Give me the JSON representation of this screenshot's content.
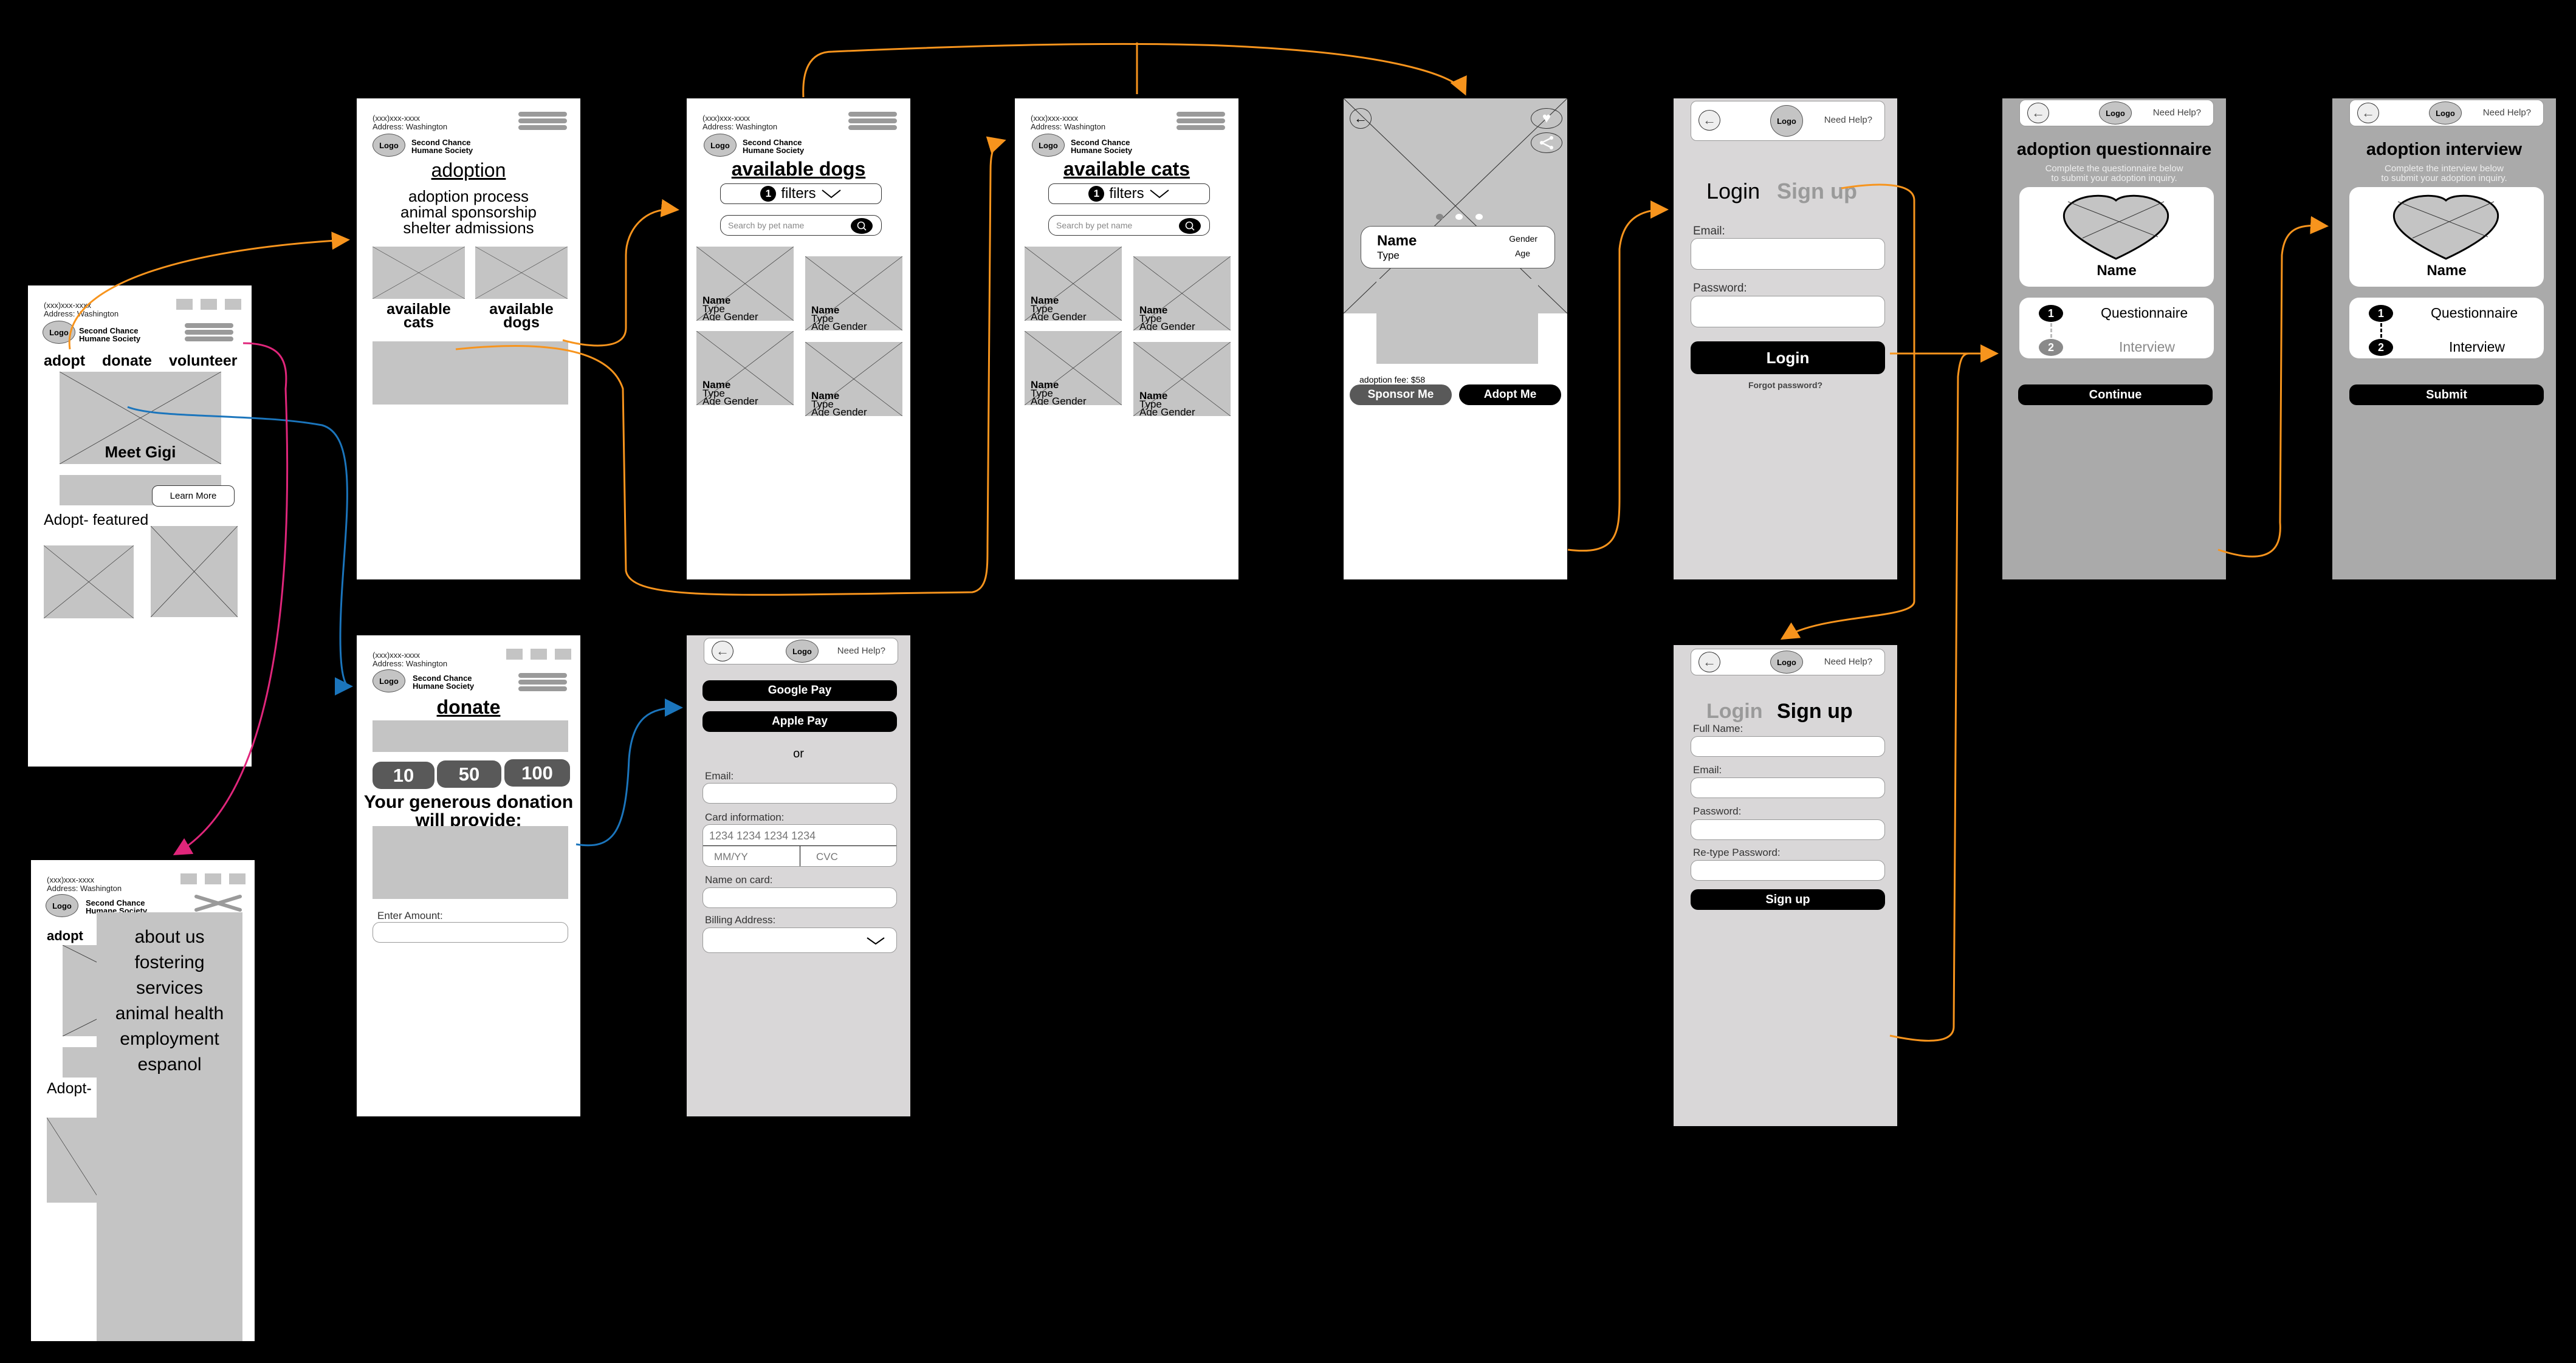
{
  "common": {
    "phone": "(xxx)xxx-xxxx",
    "address": "Address: Washington",
    "logo": "Logo",
    "org_line1": "Second Chance",
    "org_line2": "Humane Society",
    "need_help": "Need Help?"
  },
  "home": {
    "nav": [
      "adopt",
      "donate",
      "volunteer"
    ],
    "hero_caption": "Meet Gigi",
    "learn_more": "Learn More",
    "featured_heading": "Adopt- featured"
  },
  "menu": {
    "partial_nav": "adopt",
    "partial_featured": "Adopt-",
    "items": [
      "about us",
      "fostering",
      "services",
      "animal health",
      "employment",
      "espanol"
    ]
  },
  "adoption": {
    "title": "adoption",
    "links": [
      "adoption process",
      "animal sponsorship",
      "shelter admissions"
    ],
    "cats_label_1": "available",
    "cats_label_2": "cats",
    "dogs_label_1": "available",
    "dogs_label_2": "dogs"
  },
  "dogs": {
    "title": "available dogs",
    "filter_count": "1",
    "filters_label": "filters",
    "search_placeholder": "Search by pet name",
    "card": {
      "name": "Name",
      "type": "Type",
      "age_gender": "Age  Gender"
    }
  },
  "cats": {
    "title": "available cats",
    "filter_count": "1",
    "filters_label": "filters",
    "search_placeholder": "Search by pet name",
    "card": {
      "name": "Name",
      "type": "Type",
      "age_gender": "Age  Gender"
    }
  },
  "donate": {
    "title": "donate",
    "amounts": [
      "10",
      "50",
      "100"
    ],
    "provide_heading": "Your generous donation will provide:",
    "enter_amount_label": "Enter Amount:",
    "enter_amount_value": ""
  },
  "payment": {
    "google_pay": "Google Pay",
    "apple_pay": "Apple Pay",
    "or": "or",
    "email_label": "Email:",
    "card_label": "Card information:",
    "card_number_placeholder": "1234 1234 1234 1234",
    "expiry_placeholder": "MM/YY",
    "cvc_placeholder": "CVC",
    "name_label": "Name on card:",
    "billing_label": "Billing Address:"
  },
  "pet_detail": {
    "name": "Name",
    "type": "Type",
    "gender": "Gender",
    "age": "Age",
    "carousel_pages": 3,
    "carousel_active": 1,
    "fee": "adoption fee: $58",
    "sponsor": "Sponsor Me",
    "adopt": "Adopt Me"
  },
  "login": {
    "tab_login": "Login",
    "tab_signup": "Sign up",
    "email_label": "Email:",
    "password_label": "Password:",
    "login_button": "Login",
    "forgot": "Forgot password?"
  },
  "signup": {
    "tab_login": "Login",
    "tab_signup": "Sign up",
    "fullname_label": "Full Name:",
    "email_label": "Email:",
    "password_label": "Password:",
    "retype_label": "Re-type Password:",
    "signup_button": "Sign up"
  },
  "questionnaire": {
    "title": "adoption questionnaire",
    "subtitle_1": "Complete the questionnaire below",
    "subtitle_2": "to submit your adoption inquiry.",
    "pet_name": "Name",
    "step1_num": "1",
    "step1": "Questionnaire",
    "step2_num": "2",
    "step2": "Interview",
    "button": "Continue"
  },
  "interview": {
    "title": "adoption interview",
    "subtitle_1": "Complete the interview below",
    "subtitle_2": "to submit your adoption inquiry.",
    "pet_name": "Name",
    "step1_num": "1",
    "step1": "Questionnaire",
    "step2_num": "2",
    "step2": "Interview",
    "button": "Submit"
  },
  "colors": {
    "flow_adopt": "#f7941d",
    "flow_donate": "#1b75bc",
    "flow_menu": "#e0267b",
    "placeholder": "#c4c4c4",
    "form_bg": "#d9d7d8",
    "step_bg": "#aaaaaa"
  }
}
